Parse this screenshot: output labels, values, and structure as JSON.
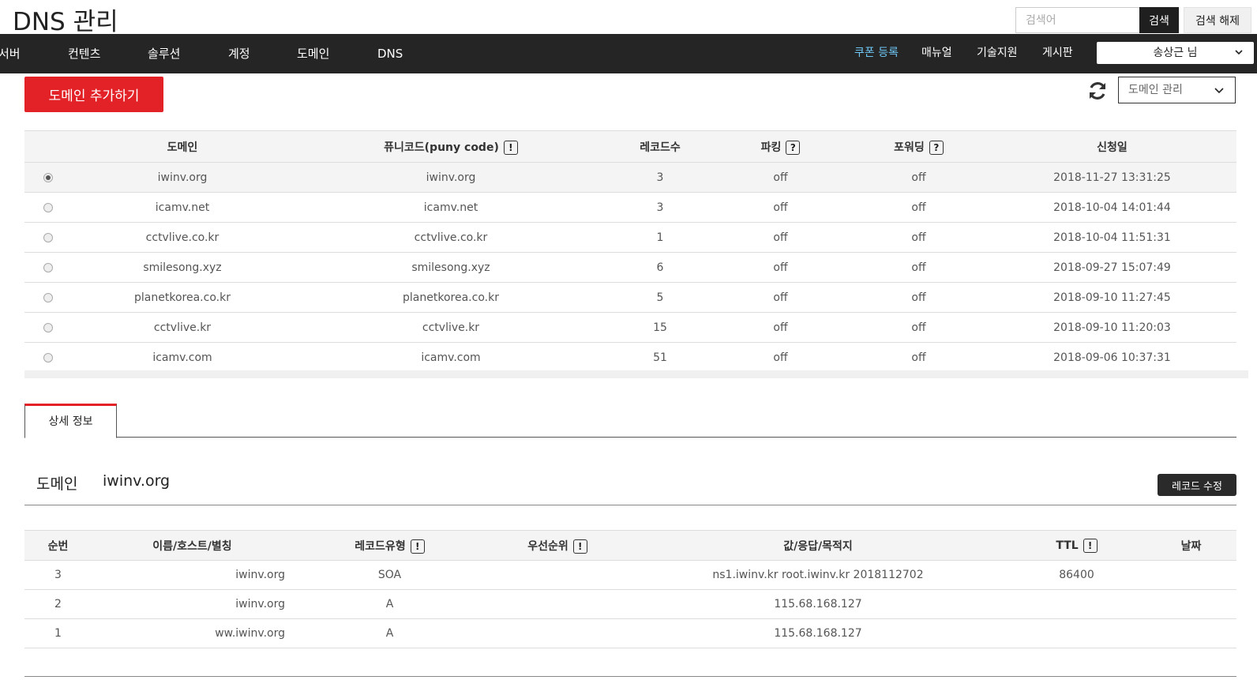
{
  "header": {
    "title": "DNS 관리",
    "search_placeholder": "검색어",
    "search_button": "검색",
    "search_reset_button": "검색 해제"
  },
  "nav": {
    "items": [
      "서버",
      "컨텐츠",
      "솔루션",
      "계정",
      "도메인",
      "DNS"
    ],
    "right_items": [
      "쿠폰 등록",
      "매뉴얼",
      "기술지원",
      "게시판"
    ],
    "accent_color": "#6fc7f5",
    "user_name": "송상근 님"
  },
  "toolbar": {
    "add_domain_button": "도메인 추가하기",
    "management_select": "도메인 관리",
    "primary_color": "#e32228"
  },
  "domain_table": {
    "columns": [
      "",
      "도메인",
      "퓨니코드(puny code)",
      "레코드수",
      "파킹",
      "포워딩",
      "신청일"
    ],
    "rows": [
      {
        "domain": "iwinv.org",
        "puny": "iwinv.org",
        "records": "3",
        "parking": "off",
        "forwarding": "off",
        "date": "2018-11-27 13:31:25",
        "selected": true
      },
      {
        "domain": "icamv.net",
        "puny": "icamv.net",
        "records": "3",
        "parking": "off",
        "forwarding": "off",
        "date": "2018-10-04 14:01:44",
        "selected": false
      },
      {
        "domain": "cctvlive.co.kr",
        "puny": "cctvlive.co.kr",
        "records": "1",
        "parking": "off",
        "forwarding": "off",
        "date": "2018-10-04 11:51:31",
        "selected": false
      },
      {
        "domain": "smilesong.xyz",
        "puny": "smilesong.xyz",
        "records": "6",
        "parking": "off",
        "forwarding": "off",
        "date": "2018-09-27 15:07:49",
        "selected": false
      },
      {
        "domain": "planetkorea.co.kr",
        "puny": "planetkorea.co.kr",
        "records": "5",
        "parking": "off",
        "forwarding": "off",
        "date": "2018-09-10 11:27:45",
        "selected": false
      },
      {
        "domain": "cctvlive.kr",
        "puny": "cctvlive.kr",
        "records": "15",
        "parking": "off",
        "forwarding": "off",
        "date": "2018-09-10 11:20:03",
        "selected": false
      },
      {
        "domain": "icamv.com",
        "puny": "icamv.com",
        "records": "51",
        "parking": "off",
        "forwarding": "off",
        "date": "2018-09-06 10:37:31",
        "selected": false
      }
    ]
  },
  "detail": {
    "tab_label": "상세 정보",
    "domain_label": "도메인",
    "domain_value": "iwinv.org",
    "record_edit_button": "레코드 수정"
  },
  "record_table": {
    "columns": [
      "순번",
      "이름/호스트/별칭",
      "레코드유형",
      "우선순위",
      "값/응답/목적지",
      "TTL",
      "날짜"
    ],
    "rows": [
      {
        "no": "3",
        "name": "iwinv.org",
        "type": "SOA",
        "priority": "",
        "value": "ns1.iwinv.kr root.iwinv.kr 2018112702",
        "ttl": "86400",
        "date": ""
      },
      {
        "no": "2",
        "name": "iwinv.org",
        "type": "A",
        "priority": "",
        "value": "115.68.168.127",
        "ttl": "",
        "date": ""
      },
      {
        "no": "1",
        "name": "ww.iwinv.org",
        "type": "A",
        "priority": "",
        "value": "115.68.168.127",
        "ttl": "",
        "date": ""
      }
    ]
  }
}
